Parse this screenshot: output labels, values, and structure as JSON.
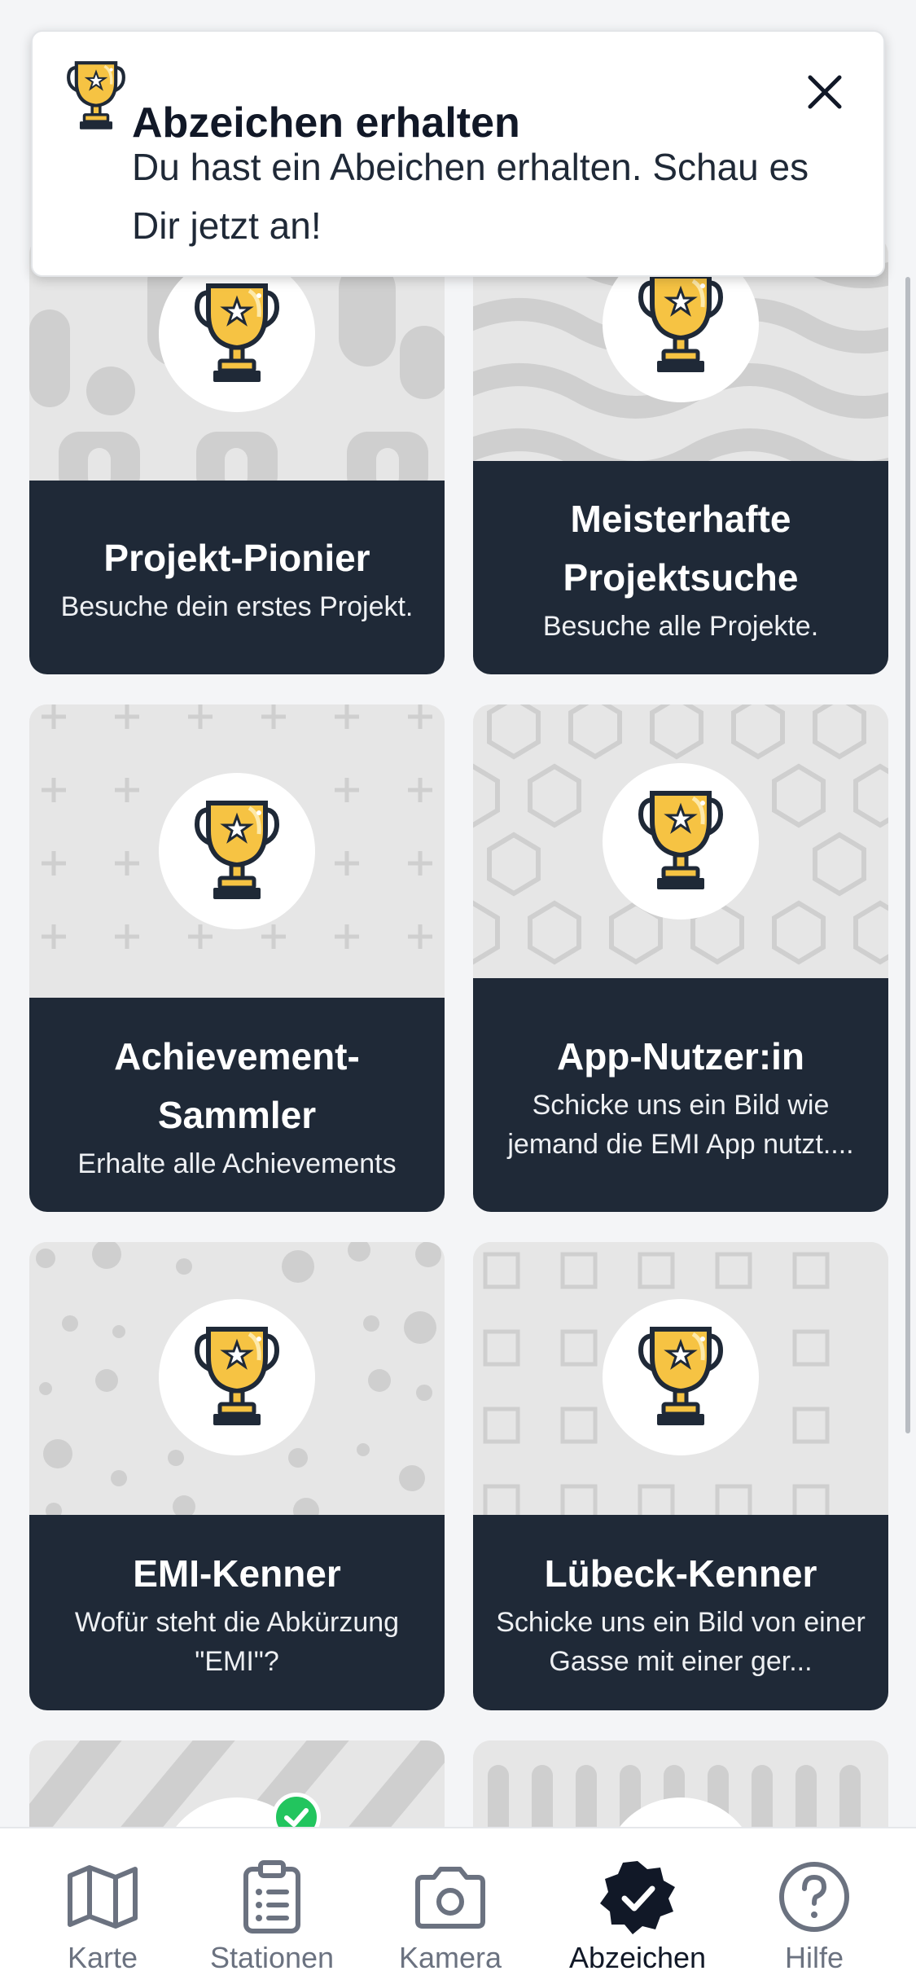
{
  "toast": {
    "title": "Abzeichen erhalten",
    "text": "Du hast ein Abeichen erhalten. Schau es Dir jetzt an!",
    "icon": "trophy-icon",
    "close_icon": "close-icon"
  },
  "cards": [
    {
      "title": "Projekt-Pionier",
      "desc": "Besuche dein erstes Projekt.",
      "pattern": "blobs",
      "unlocked": false
    },
    {
      "title": "Meisterhafte Projektsuche",
      "desc": "Besuche alle Projekte.",
      "pattern": "waves",
      "unlocked": false
    },
    {
      "title": "Achievement-Sammler",
      "desc": "Erhalte alle Achievements",
      "pattern": "plus",
      "unlocked": false
    },
    {
      "title": "App-Nutzer:in",
      "desc": "Schicke uns ein Bild wie jemand die EMI App nutzt....",
      "pattern": "hexagons",
      "unlocked": false
    },
    {
      "title": "EMI-Kenner",
      "desc": "Wofür steht die Abkürzung \"EMI\"?",
      "pattern": "dots",
      "unlocked": false
    },
    {
      "title": "Lübeck-Kenner",
      "desc": "Schicke uns ein Bild von einer Gasse mit einer ger...",
      "pattern": "squares",
      "unlocked": false
    },
    {
      "title": "",
      "desc": "",
      "pattern": "stripes",
      "unlocked": true
    },
    {
      "title": "",
      "desc": "",
      "pattern": "bars",
      "unlocked": false
    }
  ],
  "tabs": [
    {
      "label": "Karte",
      "icon": "map-icon"
    },
    {
      "label": "Stationen",
      "icon": "clipboard-list-icon"
    },
    {
      "label": "Kamera",
      "icon": "camera-icon"
    },
    {
      "label": "Abzeichen",
      "icon": "badge-check-icon",
      "active": true
    },
    {
      "label": "Hilfe",
      "icon": "help-circle-icon"
    }
  ],
  "colors": {
    "card_footer": "#1f2937",
    "pattern_bg": "#e6e6e6",
    "pattern_fg": "#c9c9c9",
    "trophy_gold": "#f6c343",
    "success_green": "#22c55e"
  }
}
